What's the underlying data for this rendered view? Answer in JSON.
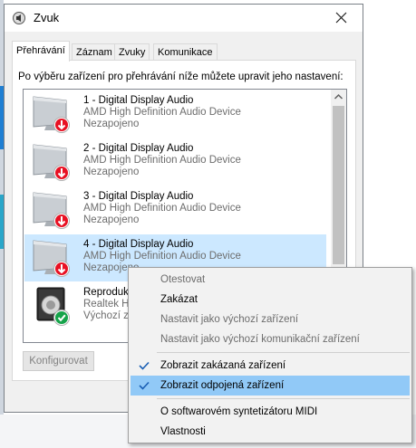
{
  "window": {
    "title": "Zvuk",
    "tabs": [
      "Přehrávání",
      "Záznam",
      "Zvuky",
      "Komunikace"
    ],
    "instruction": "Po výběru zařízení pro přehrávání níže můžete upravit jeho nastavení:",
    "configure_label": "Konfigurovat"
  },
  "devices": [
    {
      "name": "1 - Digital Display Audio",
      "driver": "AMD High Definition Audio Device",
      "status": "Nezapojeno",
      "icon": "monitor-disconnected-icon"
    },
    {
      "name": "2 - Digital Display Audio",
      "driver": "AMD High Definition Audio Device",
      "status": "Nezapojeno",
      "icon": "monitor-disconnected-icon"
    },
    {
      "name": "3 - Digital Display Audio",
      "driver": "AMD High Definition Audio Device",
      "status": "Nezapojeno",
      "icon": "monitor-disconnected-icon"
    },
    {
      "name": "4 - Digital Display Audio",
      "driver": "AMD High Definition Audio Device",
      "status": "Nezapojeno",
      "icon": "monitor-disconnected-icon",
      "selected": true
    },
    {
      "name": "Reproduk",
      "driver": "Realtek Hi",
      "status": "Výchozí za",
      "icon": "speaker-default-icon"
    }
  ],
  "context_menu": {
    "items": [
      {
        "label": "Otestovat",
        "disabled": true
      },
      {
        "label": "Zakázat",
        "disabled": false
      },
      {
        "label": "Nastavit jako výchozí zařízení",
        "disabled": true
      },
      {
        "label": "Nastavit jako výchozí komunikační zařízení",
        "disabled": true
      },
      {
        "label": "Zobrazit zakázaná zařízení",
        "checked": true
      },
      {
        "label": "Zobrazit odpojená zařízení",
        "checked": true,
        "highlighted": true
      },
      {
        "label": "O softwarovém syntetizátoru MIDI"
      },
      {
        "label": "Vlastnosti"
      }
    ]
  },
  "colors": {
    "selection": "#cce8ff",
    "menu_highlight": "#91c9f7",
    "disconnected_badge": "#e81123",
    "default_badge": "#16a34a"
  }
}
